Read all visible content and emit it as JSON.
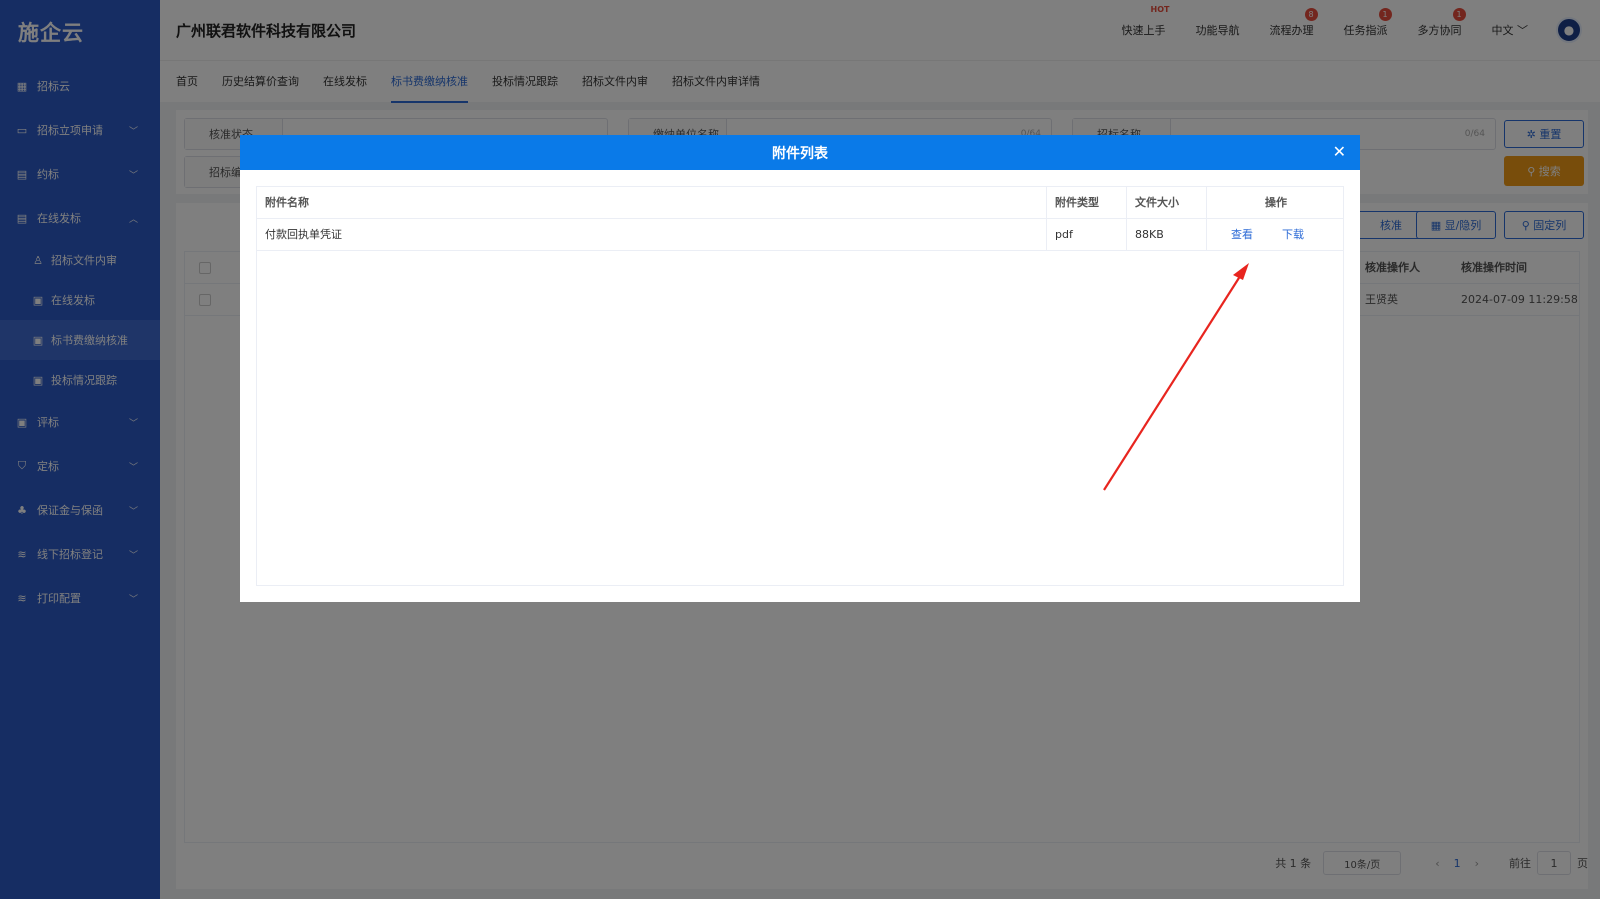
{
  "app": {
    "logo": "施企云",
    "company": "广州联君软件科技有限公司"
  },
  "header": {
    "actions": [
      {
        "label": "快速上手",
        "badge": "HOT"
      },
      {
        "label": "功能导航",
        "badge": ""
      },
      {
        "label": "流程办理",
        "badge": "8"
      },
      {
        "label": "任务指派",
        "badge": "1"
      },
      {
        "label": "多方协同",
        "badge": "1"
      }
    ],
    "language": "中文"
  },
  "sidebar": {
    "items": [
      {
        "label": "招标云"
      },
      {
        "label": "招标立项申请"
      },
      {
        "label": "约标"
      },
      {
        "label": "在线发标"
      },
      {
        "label": "招标文件内审"
      },
      {
        "label": "在线发标"
      },
      {
        "label": "标书费缴纳核准"
      },
      {
        "label": "投标情况跟踪"
      },
      {
        "label": "评标"
      },
      {
        "label": "定标"
      },
      {
        "label": "保证金与保函"
      },
      {
        "label": "线下招标登记"
      },
      {
        "label": "打印配置"
      }
    ]
  },
  "tabs": [
    "首页",
    "历史结算价查询",
    "在线发标",
    "标书费缴纳核准",
    "投标情况跟踪",
    "招标文件内审",
    "招标文件内审详情"
  ],
  "filter": {
    "field1_label": "核准状态",
    "field2_label": "缴纳单位名称",
    "field2_count": "0/64",
    "field3_label": "招标名称",
    "field3_count": "0/64",
    "field4_label": "招标编",
    "reset_label": "重置",
    "search_label": "搜索"
  },
  "toolbar": {
    "approve_label": "核准",
    "toggle_cols_label": "显/隐列",
    "fix_cols_label": "固定列"
  },
  "table": {
    "headers": {
      "approver": "核准操作人",
      "approve_time": "核准操作时间"
    },
    "rows": [
      {
        "approver": "王贤英",
        "approve_time": "2024-07-09 11:29:58"
      }
    ]
  },
  "pager": {
    "total": "共 1 条",
    "page_size": "10条/页",
    "current": "1",
    "goto_prefix": "前往",
    "goto_value": "1",
    "goto_suffix": "页"
  },
  "modal": {
    "title": "附件列表",
    "headers": [
      "附件名称",
      "附件类型",
      "文件大小",
      "操作"
    ],
    "rows": [
      {
        "name": "付款回执单凭证",
        "type": "pdf",
        "size": "88KB",
        "view": "查看",
        "download": "下载"
      }
    ]
  },
  "colors": {
    "sidebar": "#2d5bc7",
    "modal_header": "#0a7ae8",
    "accent": "#2d6bd6",
    "search": "#f09a17",
    "arrow": "#e8251f"
  }
}
